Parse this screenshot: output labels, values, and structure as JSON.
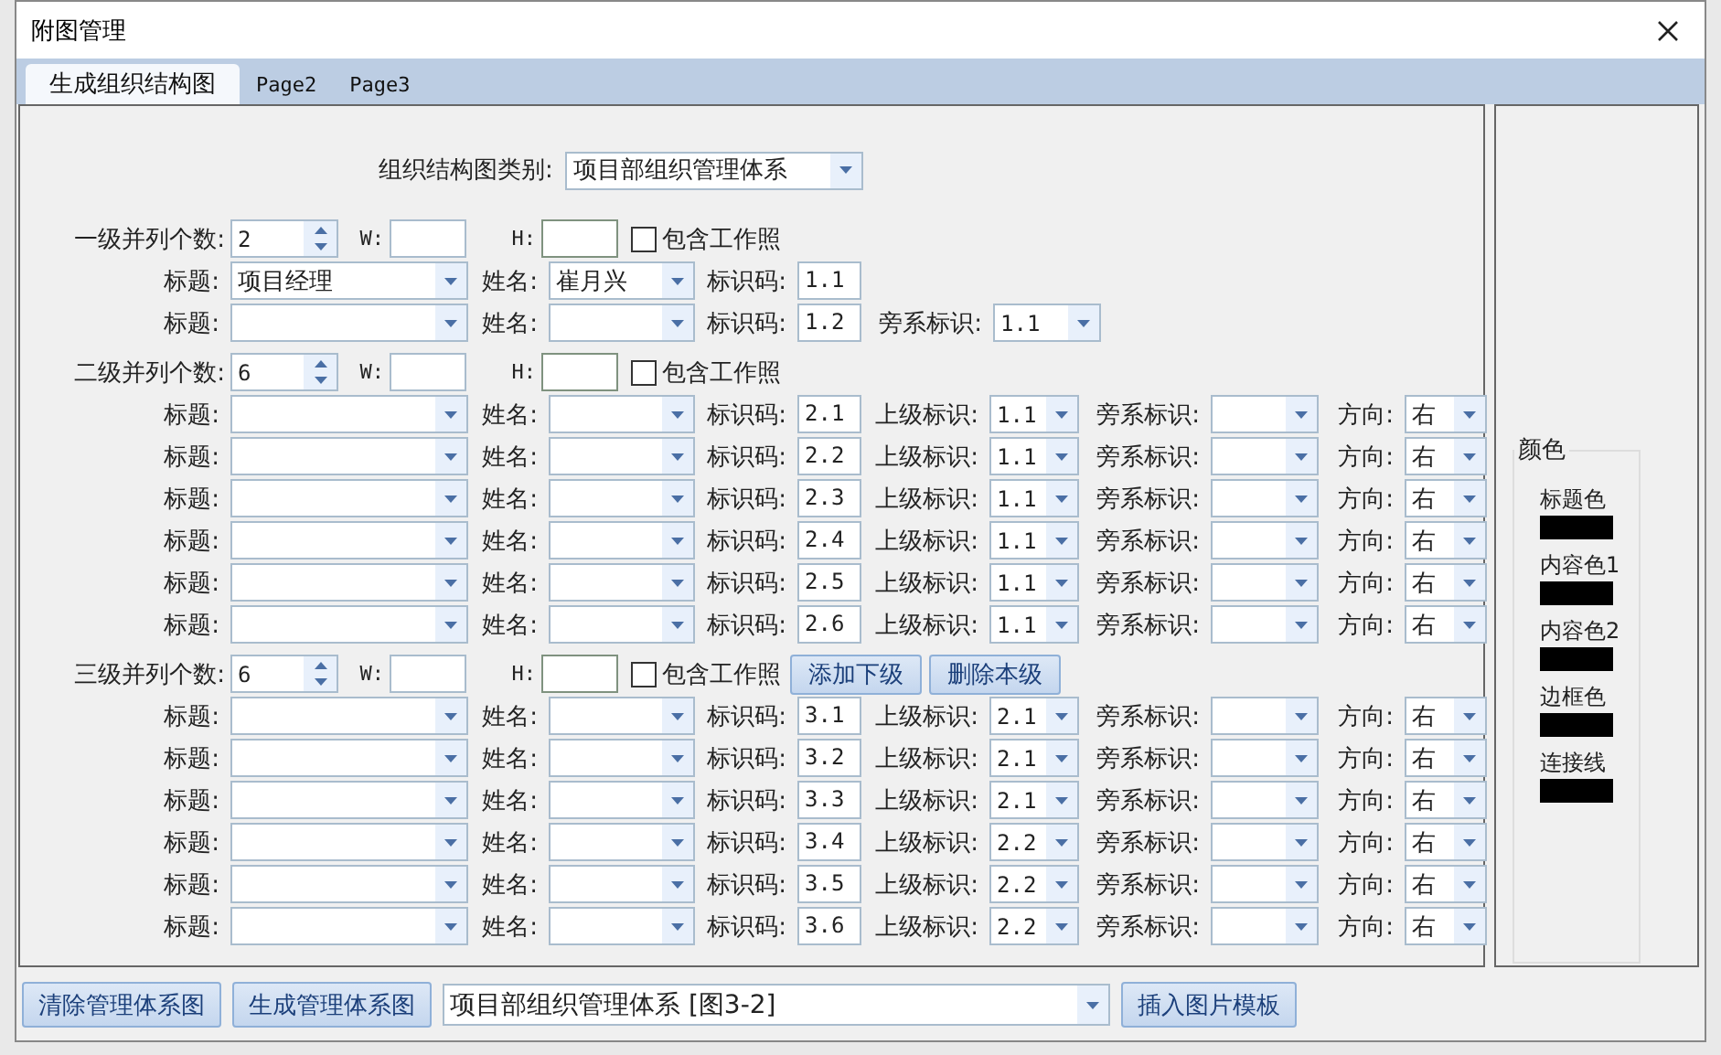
{
  "window": {
    "title": "附图管理"
  },
  "tabs": [
    {
      "label": "生成组织结构图",
      "selected": true
    },
    {
      "label": "Page2",
      "selected": false
    },
    {
      "label": "Page3",
      "selected": false
    }
  ],
  "category": {
    "label": "组织结构图类别:",
    "value": "项目部组织管理体系"
  },
  "levels": [
    {
      "count_label": "一级并列个数:",
      "count": "2",
      "w_label": "W:",
      "h_label": "H:",
      "photo": {
        "label": "包含工作照",
        "checked": false
      },
      "rows": [
        {
          "fields": [
            {
              "kind": "title",
              "label": "标题:",
              "value": "项目经理"
            },
            {
              "kind": "name",
              "label": "姓名:",
              "value": "崔月兴"
            },
            {
              "kind": "code",
              "label": "标识码:",
              "value": "1.1"
            }
          ]
        },
        {
          "fields": [
            {
              "kind": "title",
              "label": "标题:"
            },
            {
              "kind": "name",
              "label": "姓名:"
            },
            {
              "kind": "code",
              "label": "标识码:",
              "value": "1.2"
            },
            {
              "kind": "side",
              "label": "旁系标识:",
              "value": "1.1"
            }
          ]
        }
      ]
    },
    {
      "count_label": "二级并列个数:",
      "count": "6",
      "w_label": "W:",
      "h_label": "H:",
      "photo": {
        "label": "包含工作照",
        "checked": false
      },
      "rows": [
        {
          "fields": [
            {
              "kind": "title",
              "label": "标题:"
            },
            {
              "kind": "name",
              "label": "姓名:"
            },
            {
              "kind": "code",
              "label": "标识码:",
              "value": "2.1"
            },
            {
              "kind": "parent",
              "label": "上级标识:",
              "value": "1.1"
            },
            {
              "kind": "side",
              "label": "旁系标识:"
            },
            {
              "kind": "direction",
              "label": "方向:",
              "value": "右"
            }
          ]
        },
        {
          "fields": [
            {
              "kind": "title",
              "label": "标题:"
            },
            {
              "kind": "name",
              "label": "姓名:"
            },
            {
              "kind": "code",
              "label": "标识码:",
              "value": "2.2"
            },
            {
              "kind": "parent",
              "label": "上级标识:",
              "value": "1.1"
            },
            {
              "kind": "side",
              "label": "旁系标识:"
            },
            {
              "kind": "direction",
              "label": "方向:",
              "value": "右"
            }
          ]
        },
        {
          "fields": [
            {
              "kind": "title",
              "label": "标题:"
            },
            {
              "kind": "name",
              "label": "姓名:"
            },
            {
              "kind": "code",
              "label": "标识码:",
              "value": "2.3"
            },
            {
              "kind": "parent",
              "label": "上级标识:",
              "value": "1.1"
            },
            {
              "kind": "side",
              "label": "旁系标识:"
            },
            {
              "kind": "direction",
              "label": "方向:",
              "value": "右"
            }
          ]
        },
        {
          "fields": [
            {
              "kind": "title",
              "label": "标题:"
            },
            {
              "kind": "name",
              "label": "姓名:"
            },
            {
              "kind": "code",
              "label": "标识码:",
              "value": "2.4"
            },
            {
              "kind": "parent",
              "label": "上级标识:",
              "value": "1.1"
            },
            {
              "kind": "side",
              "label": "旁系标识:"
            },
            {
              "kind": "direction",
              "label": "方向:",
              "value": "右"
            }
          ]
        },
        {
          "fields": [
            {
              "kind": "title",
              "label": "标题:"
            },
            {
              "kind": "name",
              "label": "姓名:"
            },
            {
              "kind": "code",
              "label": "标识码:",
              "value": "2.5"
            },
            {
              "kind": "parent",
              "label": "上级标识:",
              "value": "1.1"
            },
            {
              "kind": "side",
              "label": "旁系标识:"
            },
            {
              "kind": "direction",
              "label": "方向:",
              "value": "右"
            }
          ]
        },
        {
          "fields": [
            {
              "kind": "title",
              "label": "标题:"
            },
            {
              "kind": "name",
              "label": "姓名:"
            },
            {
              "kind": "code",
              "label": "标识码:",
              "value": "2.6"
            },
            {
              "kind": "parent",
              "label": "上级标识:",
              "value": "1.1"
            },
            {
              "kind": "side",
              "label": "旁系标识:"
            },
            {
              "kind": "direction",
              "label": "方向:",
              "value": "右"
            }
          ]
        }
      ]
    },
    {
      "count_label": "三级并列个数:",
      "count": "6",
      "w_label": "W:",
      "h_label": "H:",
      "photo": {
        "label": "包含工作照",
        "checked": false
      },
      "buttons": [
        "添加下级",
        "删除本级"
      ],
      "rows": [
        {
          "fields": [
            {
              "kind": "title",
              "label": "标题:"
            },
            {
              "kind": "name",
              "label": "姓名:"
            },
            {
              "kind": "code",
              "label": "标识码:",
              "value": "3.1"
            },
            {
              "kind": "parent",
              "label": "上级标识:",
              "value": "2.1"
            },
            {
              "kind": "side",
              "label": "旁系标识:"
            },
            {
              "kind": "direction",
              "label": "方向:",
              "value": "右"
            }
          ]
        },
        {
          "fields": [
            {
              "kind": "title",
              "label": "标题:"
            },
            {
              "kind": "name",
              "label": "姓名:"
            },
            {
              "kind": "code",
              "label": "标识码:",
              "value": "3.2"
            },
            {
              "kind": "parent",
              "label": "上级标识:",
              "value": "2.1"
            },
            {
              "kind": "side",
              "label": "旁系标识:"
            },
            {
              "kind": "direction",
              "label": "方向:",
              "value": "右"
            }
          ]
        },
        {
          "fields": [
            {
              "kind": "title",
              "label": "标题:"
            },
            {
              "kind": "name",
              "label": "姓名:"
            },
            {
              "kind": "code",
              "label": "标识码:",
              "value": "3.3"
            },
            {
              "kind": "parent",
              "label": "上级标识:",
              "value": "2.1"
            },
            {
              "kind": "side",
              "label": "旁系标识:"
            },
            {
              "kind": "direction",
              "label": "方向:",
              "value": "右"
            }
          ]
        },
        {
          "fields": [
            {
              "kind": "title",
              "label": "标题:"
            },
            {
              "kind": "name",
              "label": "姓名:"
            },
            {
              "kind": "code",
              "label": "标识码:",
              "value": "3.4"
            },
            {
              "kind": "parent",
              "label": "上级标识:",
              "value": "2.2"
            },
            {
              "kind": "side",
              "label": "旁系标识:"
            },
            {
              "kind": "direction",
              "label": "方向:",
              "value": "右"
            }
          ]
        },
        {
          "fields": [
            {
              "kind": "title",
              "label": "标题:"
            },
            {
              "kind": "name",
              "label": "姓名:"
            },
            {
              "kind": "code",
              "label": "标识码:",
              "value": "3.5"
            },
            {
              "kind": "parent",
              "label": "上级标识:",
              "value": "2.2"
            },
            {
              "kind": "side",
              "label": "旁系标识:"
            },
            {
              "kind": "direction",
              "label": "方向:",
              "value": "右"
            }
          ]
        },
        {
          "fields": [
            {
              "kind": "title",
              "label": "标题:"
            },
            {
              "kind": "name",
              "label": "姓名:"
            },
            {
              "kind": "code",
              "label": "标识码:",
              "value": "3.6"
            },
            {
              "kind": "parent",
              "label": "上级标识:",
              "value": "2.2"
            },
            {
              "kind": "side",
              "label": "旁系标识:"
            },
            {
              "kind": "direction",
              "label": "方向:",
              "value": "右"
            }
          ]
        }
      ]
    }
  ],
  "colors": {
    "title": "颜色",
    "items": [
      {
        "label": "标题色",
        "color": "#000000"
      },
      {
        "label": "内容色1",
        "color": "#000000"
      },
      {
        "label": "内容色2",
        "color": "#000000"
      },
      {
        "label": "边框色",
        "color": "#000000"
      },
      {
        "label": "连接线",
        "color": "#000000"
      }
    ]
  },
  "bottom": {
    "buttons": [
      "清除管理体系图",
      "生成管理体系图"
    ],
    "template": "项目部组织管理体系 [图3-2]",
    "insert_button": "插入图片模板"
  }
}
